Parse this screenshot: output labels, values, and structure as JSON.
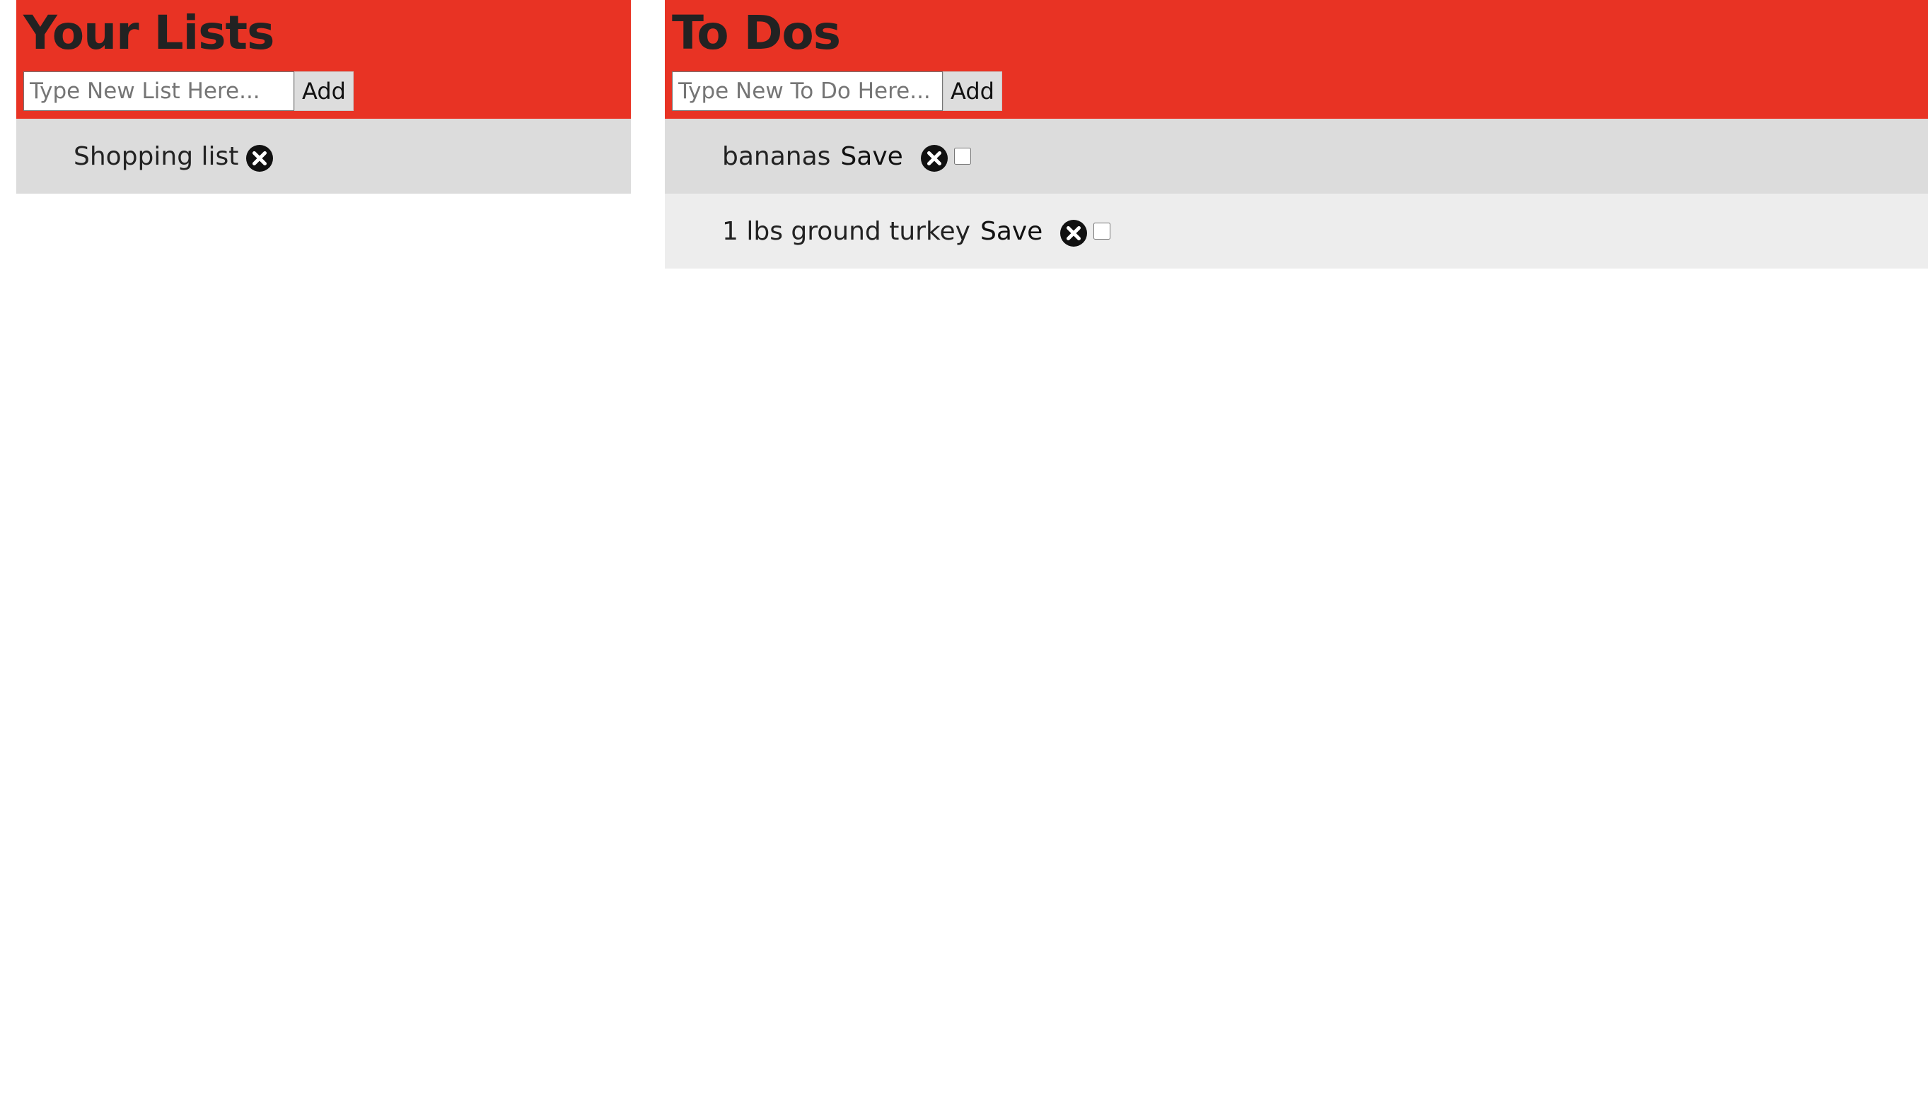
{
  "lists_panel": {
    "title": "Your Lists",
    "input_placeholder": "Type New List Here...",
    "add_label": "Add",
    "items": [
      {
        "label": "Shopping list",
        "remove_icon": "close-circle-icon"
      }
    ]
  },
  "todos_panel": {
    "title": "To Dos",
    "input_placeholder": "Type New To Do Here...",
    "add_label": "Add",
    "items": [
      {
        "label": "bananas",
        "save_label": "Save",
        "done": false,
        "remove_icon": "close-circle-icon"
      },
      {
        "label": "1 lbs ground turkey",
        "save_label": "Save",
        "done": false,
        "remove_icon": "close-circle-icon"
      }
    ]
  },
  "colors": {
    "header_bg": "#e83324",
    "row_odd_bg": "#dcdcdc",
    "row_even_bg": "#ededed",
    "title_text": "#222222",
    "icon": "#111111"
  }
}
